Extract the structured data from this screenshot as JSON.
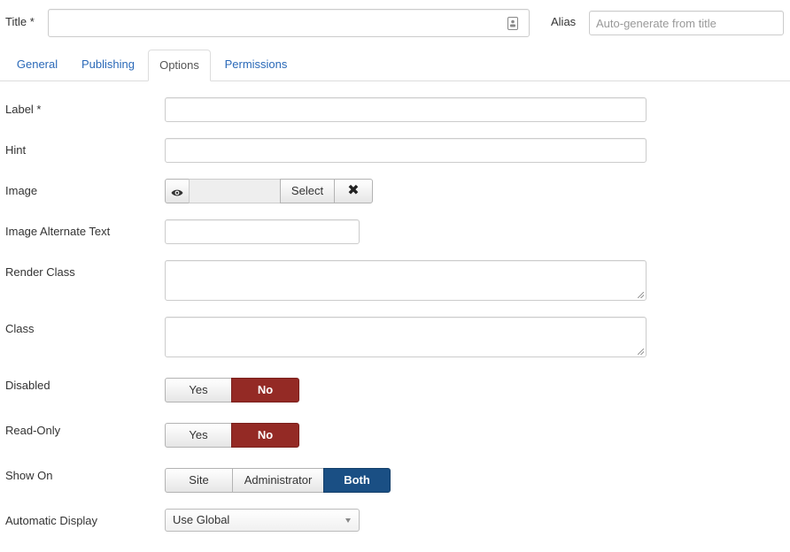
{
  "header": {
    "title_label": "Title *",
    "title_value": "",
    "alias_label": "Alias",
    "alias_placeholder": "Auto-generate from title"
  },
  "tabs": [
    {
      "label": "General"
    },
    {
      "label": "Publishing"
    },
    {
      "label": "Options",
      "active": true
    },
    {
      "label": "Permissions"
    }
  ],
  "form": {
    "label": {
      "label": "Label *",
      "value": ""
    },
    "hint": {
      "label": "Hint",
      "value": ""
    },
    "image": {
      "label": "Image",
      "value": "",
      "select_label": "Select",
      "clear_glyph": "✖"
    },
    "image_alt": {
      "label": "Image Alternate Text",
      "value": ""
    },
    "render_class": {
      "label": "Render Class",
      "value": ""
    },
    "class": {
      "label": "Class",
      "value": ""
    },
    "disabled": {
      "label": "Disabled",
      "options": [
        "Yes",
        "No"
      ],
      "selected": "No"
    },
    "read_only": {
      "label": "Read-Only",
      "options": [
        "Yes",
        "No"
      ],
      "selected": "No"
    },
    "show_on": {
      "label": "Show On",
      "options": [
        "Site",
        "Administrator",
        "Both"
      ],
      "selected": "Both"
    },
    "automatic_display": {
      "label": "Automatic Display",
      "selected": "Use Global"
    }
  },
  "colors": {
    "tab_link": "#2a69b8",
    "danger": "#942a25",
    "primary": "#1a4f84"
  }
}
